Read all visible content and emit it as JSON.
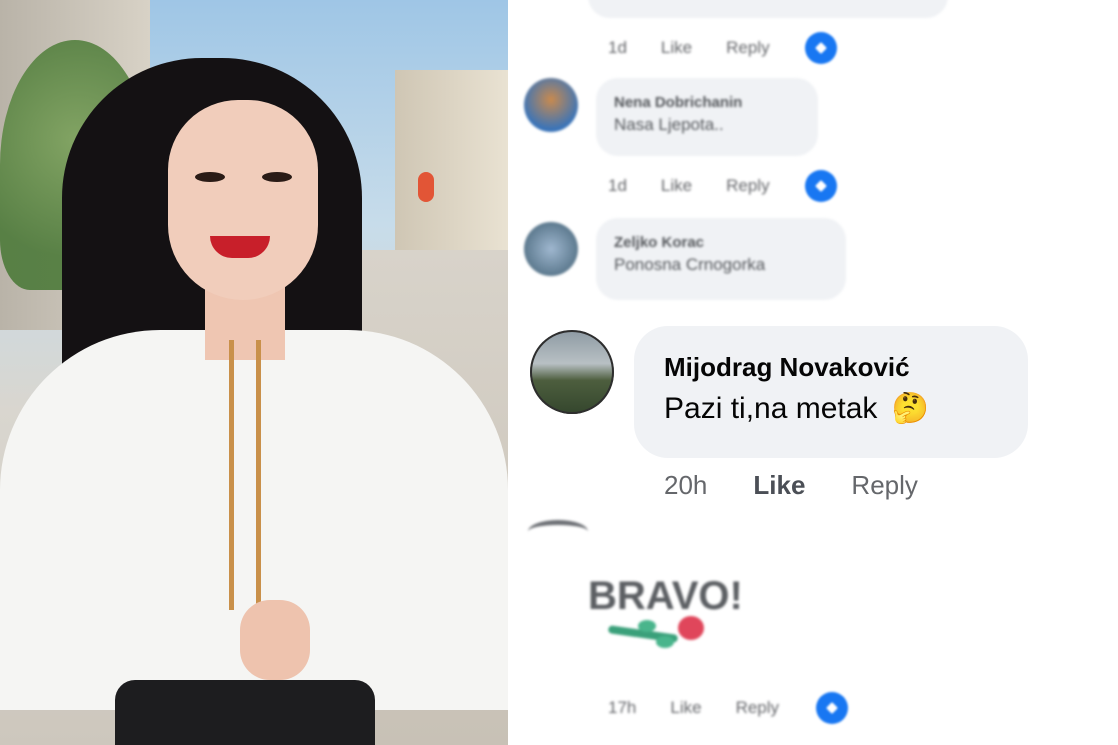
{
  "comments": [
    {
      "meta": {
        "time": "1d",
        "like": "Like",
        "reply": "Reply"
      }
    },
    {
      "name": "Nena Dobrichanin",
      "text": "Nasa Ljepota..",
      "meta": {
        "time": "1d",
        "like": "Like",
        "reply": "Reply"
      }
    },
    {
      "name": "Zeljko Korac",
      "text": "Ponosna Crnogorka"
    },
    {
      "name": "Mijodrag Novaković",
      "text": "Pazi ti,na metak",
      "emoji": "🤔",
      "meta": {
        "time": "20h",
        "like": "Like",
        "reply": "Reply"
      }
    },
    {
      "text": "BRAVO!",
      "meta": {
        "time": "17h",
        "like": "Like",
        "reply": "Reply"
      }
    }
  ],
  "colors": {
    "reaction": "#1877f2",
    "bubble": "#f0f2f5",
    "meta_text": "#65676b"
  },
  "icons": {
    "reaction": "like-reaction-icon",
    "rose": "rose-sticker-icon"
  }
}
